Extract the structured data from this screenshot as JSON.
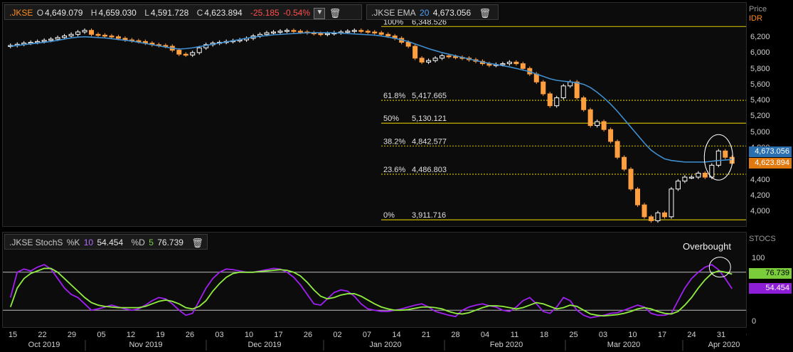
{
  "price_legend": {
    "symbol": ".JKSE",
    "open_label": "O",
    "open": "4,649.079",
    "high_label": "H",
    "high": "4,659.030",
    "low_label": "L",
    "low": "4,591.728",
    "close_label": "C",
    "close": "4,623.894",
    "change": "-25.185",
    "change_pct": "-0.54%"
  },
  "ema_legend": {
    "label": ".JKSE EMA",
    "period": "20",
    "value": "4,673.056"
  },
  "stoch_legend": {
    "label": ".JKSE StochS",
    "k_label": "%K",
    "k_period": "10",
    "k_value": "54.454",
    "d_label": "%D",
    "d_period": "5",
    "d_value": "76.739"
  },
  "price_axis": {
    "title": "Price",
    "unit": "IDR"
  },
  "stoch_axis": {
    "title": "STOCS"
  },
  "badges": {
    "ema": "4,673.056",
    "last": "4,623.894",
    "d": "76.739",
    "k": "54.454"
  },
  "annotation": "Overbought",
  "colors": {
    "up": "#ffffff",
    "down": "#ff9f40",
    "ema": "#3f8fd0",
    "k": "#a020f0",
    "d": "#90ee40",
    "fib": "#c8b400"
  },
  "chart_data": [
    {
      "type": "candlestick",
      "title": ".JKSE",
      "ylabel": "Price IDR",
      "ylim": [
        3850,
        6450
      ],
      "yticks": [
        "4,000",
        "4,200",
        "4,400",
        "4,600",
        "4,800",
        "5,000",
        "5,200",
        "5,400",
        "5,600",
        "5,800",
        "6,000",
        "6,200"
      ],
      "x_ticks": [
        "15",
        "22",
        "29",
        "05",
        "12",
        "19",
        "26",
        "03",
        "10",
        "17",
        "26",
        "02",
        "07",
        "14",
        "21",
        "28",
        "04",
        "11",
        "18",
        "25",
        "03",
        "10",
        "17",
        "24",
        "31",
        "07"
      ],
      "x_months": [
        "Oct 2019",
        "Nov 2019",
        "Dec 2019",
        "Jan 2020",
        "Feb 2020",
        "Mar 2020",
        "Apr 2020"
      ],
      "fibonacci": [
        {
          "level": "100%",
          "value": "6,348.526",
          "price": 6348.526
        },
        {
          "level": "61.8%",
          "value": "5,417.665",
          "price": 5417.665
        },
        {
          "level": "50%",
          "value": "5,130.121",
          "price": 5130.121
        },
        {
          "level": "38.2%",
          "value": "4,842.577",
          "price": 4842.577
        },
        {
          "level": "23.6%",
          "value": "4,486.803",
          "price": 4486.803
        },
        {
          "level": "0%",
          "value": "3,911.716",
          "price": 3911.716
        }
      ],
      "close_series": [
        6110,
        6125,
        6140,
        6150,
        6160,
        6175,
        6190,
        6210,
        6230,
        6250,
        6280,
        6300,
        6250,
        6240,
        6230,
        6220,
        6200,
        6180,
        6170,
        6160,
        6140,
        6120,
        6110,
        6100,
        6050,
        6000,
        5990,
        6020,
        6080,
        6120,
        6140,
        6150,
        6160,
        6170,
        6180,
        6200,
        6230,
        6250,
        6270,
        6280,
        6290,
        6300,
        6290,
        6280,
        6270,
        6260,
        6250,
        6260,
        6270,
        6280,
        6290,
        6300,
        6290,
        6280,
        6270,
        6250,
        6230,
        6200,
        6150,
        6100,
        5950,
        5900,
        5920,
        5950,
        5980,
        5970,
        5960,
        5950,
        5930,
        5910,
        5880,
        5860,
        5870,
        5880,
        5900,
        5880,
        5820,
        5750,
        5650,
        5500,
        5350,
        5450,
        5600,
        5650,
        5450,
        5300,
        5100,
        5150,
        5050,
        4900,
        4700,
        4550,
        4300,
        4100,
        3950,
        3900,
        4000,
        3950,
        4300,
        4400,
        4450,
        4450,
        4500,
        4450,
        4600,
        4780,
        4700,
        4624
      ],
      "ema20": [
        6100,
        6110,
        6120,
        6130,
        6140,
        6150,
        6160,
        6175,
        6190,
        6205,
        6215,
        6220,
        6215,
        6210,
        6205,
        6195,
        6185,
        6175,
        6165,
        6150,
        6135,
        6120,
        6105,
        6090,
        6075,
        6065,
        6070,
        6080,
        6095,
        6110,
        6125,
        6140,
        6155,
        6170,
        6185,
        6200,
        6215,
        6225,
        6235,
        6245,
        6250,
        6255,
        6260,
        6265,
        6270,
        6272,
        6270,
        6270,
        6270,
        6265,
        6260,
        6255,
        6250,
        6245,
        6240,
        6230,
        6215,
        6200,
        6180,
        6160,
        6130,
        6100,
        6070,
        6045,
        6020,
        6000,
        5980,
        5960,
        5940,
        5920,
        5900,
        5885,
        5870,
        5855,
        5840,
        5820,
        5800,
        5780,
        5750,
        5720,
        5690,
        5670,
        5660,
        5650,
        5640,
        5620,
        5580,
        5520,
        5450,
        5370,
        5280,
        5180,
        5080,
        4980,
        4880,
        4790,
        4730,
        4680,
        4660,
        4650,
        4640,
        4640,
        4640,
        4640,
        4650,
        4660,
        4665,
        4673
      ]
    },
    {
      "type": "line",
      "title": ".JKSE StochS",
      "ylim": [
        0,
        100
      ],
      "yticks": [
        "0",
        "100"
      ],
      "reference_lines": [
        80,
        20
      ],
      "series": [
        {
          "name": "%K",
          "values": [
            40,
            80,
            85,
            82,
            88,
            92,
            85,
            70,
            55,
            45,
            40,
            30,
            20,
            22,
            25,
            28,
            25,
            22,
            20,
            22,
            28,
            35,
            40,
            38,
            30,
            20,
            12,
            15,
            35,
            55,
            70,
            80,
            85,
            84,
            82,
            80,
            80,
            82,
            84,
            86,
            85,
            80,
            72,
            60,
            45,
            30,
            28,
            38,
            48,
            52,
            50,
            42,
            30,
            22,
            20,
            18,
            18,
            20,
            22,
            25,
            28,
            30,
            25,
            18,
            15,
            12,
            10,
            20,
            25,
            28,
            30,
            27,
            25,
            20,
            18,
            25,
            35,
            40,
            30,
            18,
            15,
            25,
            40,
            35,
            20,
            12,
            8,
            10,
            12,
            15,
            16,
            20,
            24,
            28,
            25,
            15,
            12,
            12,
            15,
            35,
            55,
            70,
            80,
            88,
            92,
            84,
            70,
            54
          ]
        },
        {
          "name": "%D",
          "values": [
            25,
            55,
            70,
            78,
            82,
            86,
            86,
            80,
            70,
            60,
            50,
            40,
            32,
            28,
            26,
            25,
            24,
            24,
            24,
            24,
            26,
            30,
            34,
            36,
            34,
            30,
            24,
            22,
            26,
            35,
            50,
            62,
            72,
            78,
            80,
            80,
            80,
            81,
            82,
            83,
            84,
            83,
            80,
            74,
            64,
            52,
            42,
            38,
            40,
            44,
            46,
            46,
            42,
            36,
            30,
            25,
            22,
            20,
            20,
            21,
            23,
            25,
            25,
            24,
            22,
            18,
            15,
            14,
            16,
            20,
            24,
            27,
            27,
            26,
            24,
            22,
            24,
            28,
            32,
            30,
            26,
            22,
            24,
            28,
            26,
            20,
            14,
            12,
            11,
            12,
            13,
            15,
            18,
            22,
            24,
            22,
            18,
            15,
            14,
            18,
            28,
            40,
            55,
            68,
            78,
            82,
            80,
            77
          ]
        }
      ]
    }
  ]
}
